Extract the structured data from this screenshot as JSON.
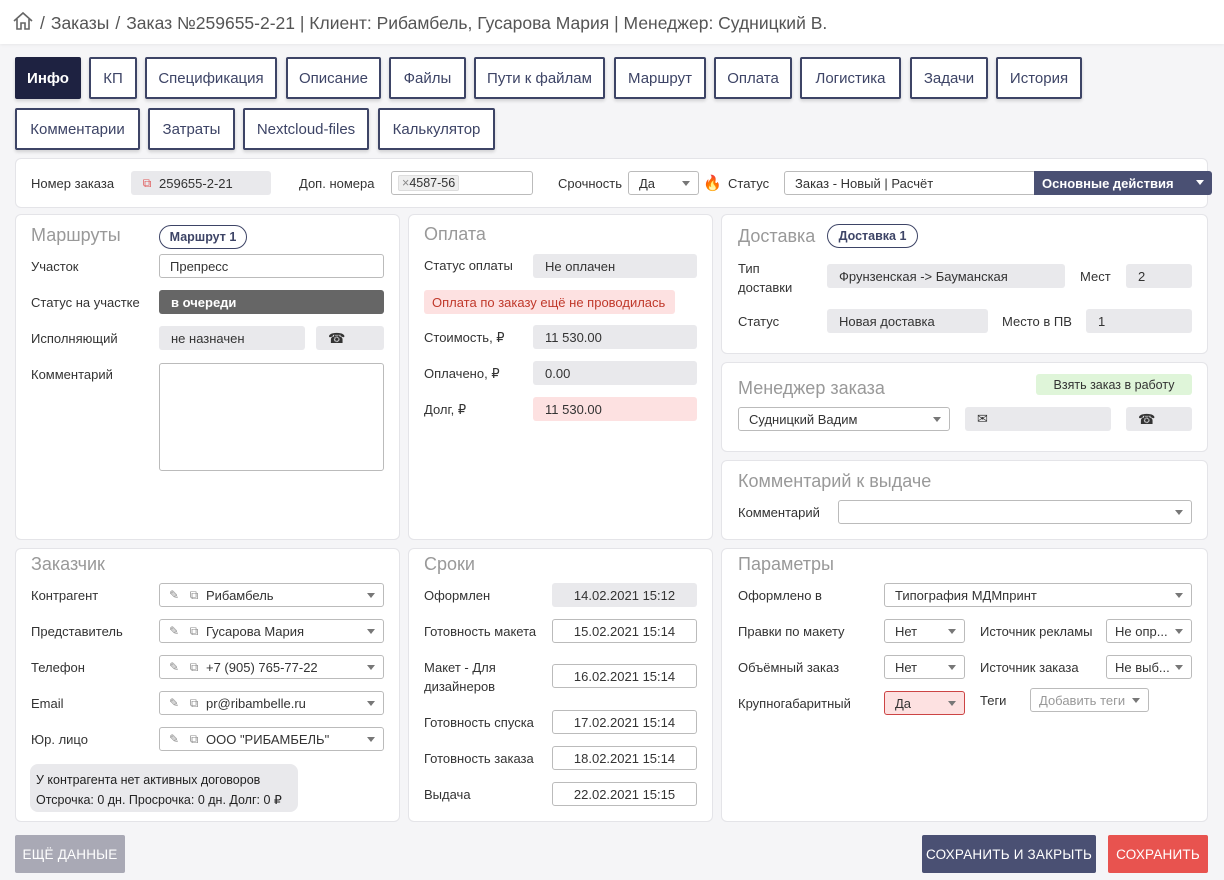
{
  "breadcrumb": {
    "sep1": "/",
    "orders": "Заказы",
    "sep2": "/",
    "order": "Заказ №259655-2-21 | Клиент: Рибамбель, Гусарова Мария | Менеджер: Судницкий В."
  },
  "tabs": [
    "Инфо",
    "КП",
    "Спецификация",
    "Описание",
    "Файлы",
    "Пути к файлам",
    "Маршрут",
    "Оплата",
    "Логистика",
    "Задачи",
    "История",
    "Комментарии",
    "Затраты",
    "Nextcloud-files",
    "Калькулятор"
  ],
  "topbar": {
    "order_no_label": "Номер заказа",
    "order_no": "259655-2-21",
    "extra_label": "Доп. номера",
    "extra_tag": "4587-56",
    "tag_remove": "×",
    "urgency_label": "Срочность",
    "urgency": "Да",
    "status_label": "Статус",
    "status": "Заказ - Новый | Расчёт",
    "actions": "Основные действия"
  },
  "routes": {
    "title": "Маршруты",
    "pill": "Маршрут 1",
    "area_label": "Участок",
    "area": "Препресс",
    "area_status_label": "Статус на участке",
    "area_status": "в очереди",
    "executor_label": "Исполняющий",
    "executor": "не назначен",
    "comment_label": "Комментарий",
    "comment": ""
  },
  "payment": {
    "title": "Оплата",
    "status_label": "Статус оплаты",
    "status": "Не оплачен",
    "notice": "Оплата по заказу ещё не проводилась",
    "cost_label": "Стоимость, ₽",
    "cost": "11 530.00",
    "paid_label": "Оплачено, ₽",
    "paid": "0.00",
    "debt_label": "Долг, ₽",
    "debt": "11 530.00"
  },
  "delivery": {
    "title": "Доставка",
    "pill": "Доставка 1",
    "type_label": "Тип доставки",
    "type": "Фрунзенская -> Бауманская",
    "places_label": "Мест",
    "places": "2",
    "status_label": "Статус",
    "status": "Новая доставка",
    "pv_label": "Место в ПВ",
    "pv": "1"
  },
  "manager": {
    "title": "Менеджер заказа",
    "take": "Взять заказ в работу",
    "name": "Судницкий Вадим",
    "email": "",
    "phone": ""
  },
  "issue": {
    "title": "Комментарий к выдаче",
    "comment_label": "Комментарий",
    "comment": ""
  },
  "customer": {
    "title": "Заказчик",
    "contractor_label": "Контрагент",
    "contractor": "Рибамбель",
    "rep_label": "Представитель",
    "rep": "Гусарова Мария",
    "phone_label": "Телефон",
    "phone": "+7 (905) 765-77-22",
    "email_label": "Email",
    "email": "pr@ribambelle.ru",
    "legal_label": "Юр. лицо",
    "legal": "ООО \"РИБАМБЕЛЬ\"",
    "note1": "У контрагента нет активных договоров",
    "note2": "Отсрочка: 0 дн. Просрочка: 0 дн. Долг: 0 ₽"
  },
  "dates": {
    "title": "Сроки",
    "created_label": "Оформлен",
    "created": "14.02.2021 15:12",
    "layout_label": "Готовность макета",
    "layout": "15.02.2021 15:14",
    "designers_label": "Макет - Для дизайнеров",
    "designers": "16.02.2021 15:14",
    "descent_label": "Готовность спуска",
    "descent": "17.02.2021 15:14",
    "ready_label": "Готовность заказа",
    "ready": "18.02.2021 15:14",
    "issue_label": "Выдача",
    "issue": "22.02.2021 15:15"
  },
  "params": {
    "title": "Параметры",
    "issued_in_label": "Оформлено в",
    "issued_in": "Типография МДМпринт",
    "edits_label": "Правки по макету",
    "edits": "Нет",
    "ad_label": "Источник рекламы",
    "ad": "Не опр...",
    "bulk_label": "Объёмный заказ",
    "bulk": "Нет",
    "src_label": "Источник заказа",
    "src": "Не выб...",
    "large_label": "Крупногабаритный",
    "large": "Да",
    "tags_label": "Теги",
    "tags": "Добавить теги"
  },
  "footer": {
    "more": "ЕЩЁ ДАННЫЕ",
    "save_close": "СОХРАНИТЬ И ЗАКРЫТЬ",
    "save": "СОХРАНИТЬ"
  }
}
